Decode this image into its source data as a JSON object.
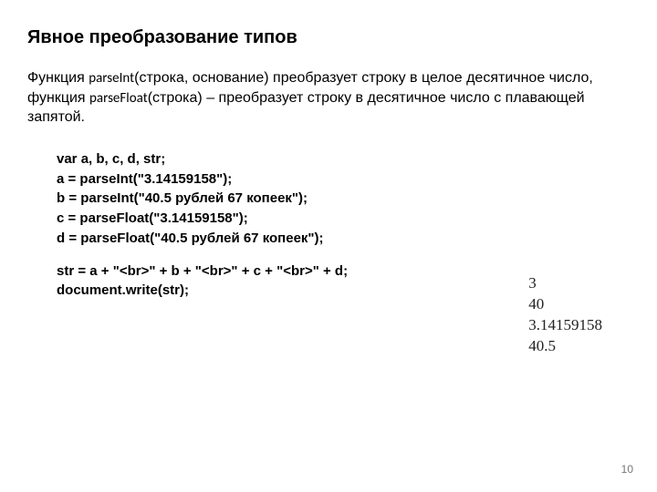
{
  "heading": "Явное преобразование типов",
  "paragraph": {
    "t1": "Функция ",
    "f1": "parseInt",
    "t2": "(строка, основание) преобразует строку в целое десятичное число, функция ",
    "f2": "parseFloat",
    "t3": "(строка) – преобразует строку в десятичное число с плавающей запятой."
  },
  "code": {
    "l1": "var a, b, c, d, str;",
    "l2": "a = parseInt(\"3.14159158\");",
    "l3": "b = parseInt(\"40.5 рублей 67 копеек\");",
    "l4": "c = parseFloat(\"3.14159158\");",
    "l5": "d = parseFloat(\"40.5 рублей 67 копеек\");",
    "l6": "str = a + \"<br>\" + b + \"<br>\" + c + \"<br>\" + d;",
    "l7": "document.write(str);"
  },
  "output": {
    "o1": "3",
    "o2": "40",
    "o3": "3.14159158",
    "o4": "40.5"
  },
  "page_number": "10"
}
